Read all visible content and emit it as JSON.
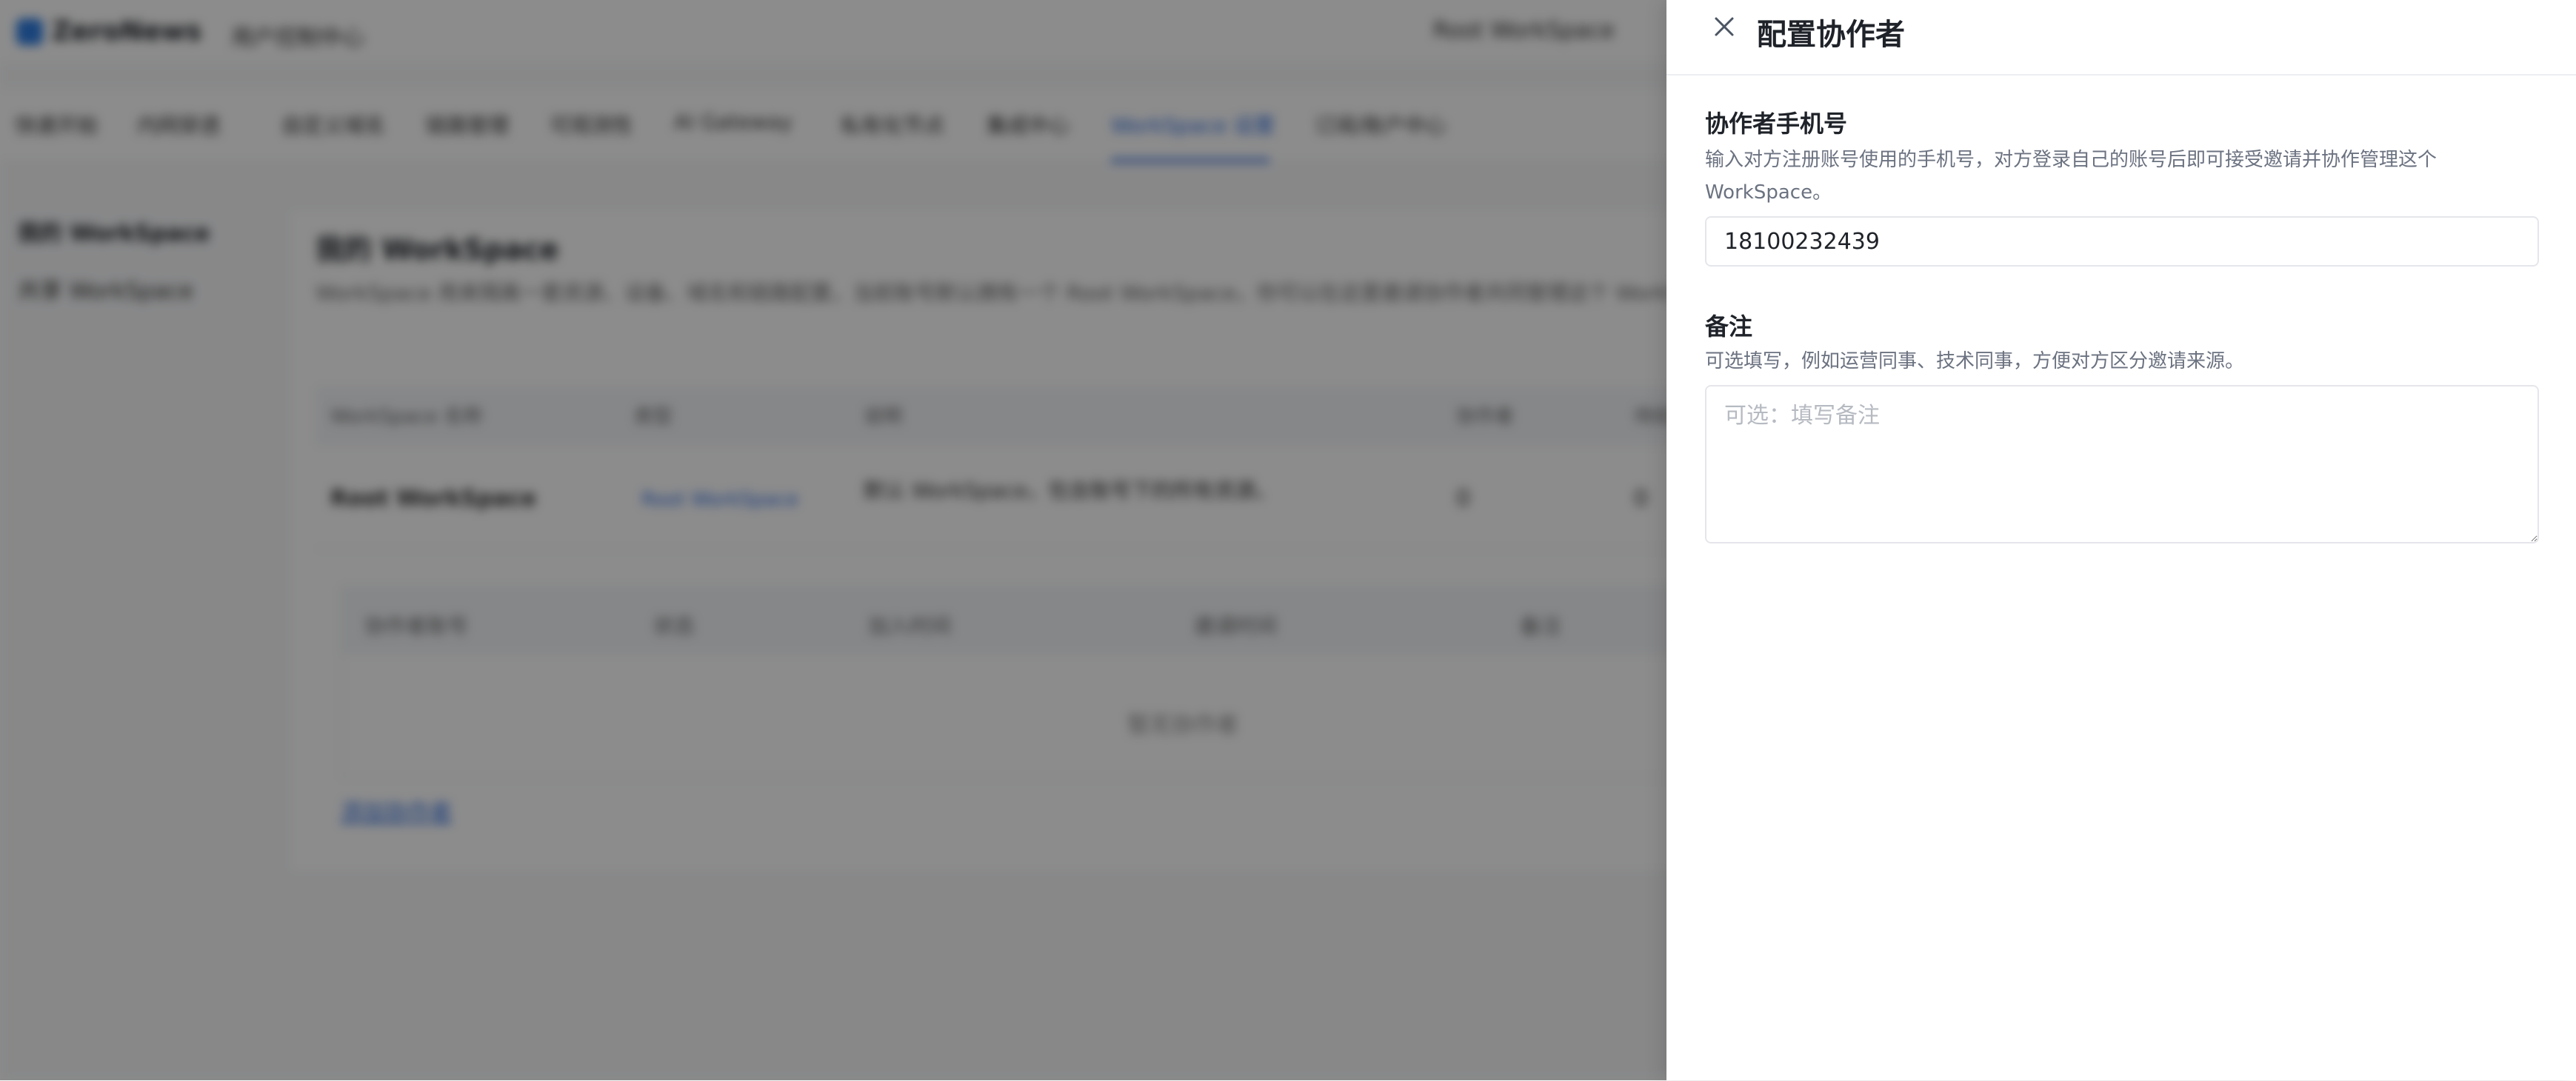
{
  "background": {
    "brand_name": "ZeroNews",
    "app_subtitle": "用户控制中心",
    "workspace_switch": "Root WorkSpace",
    "nav_items": [
      "快速开始",
      "内网穿透",
      "自定义域名",
      "链路管理",
      "可观测性",
      "AI Gateway",
      "私有化节点",
      "集成中心",
      "WorkSpace 设置",
      "订阅/账户中心"
    ],
    "side_items": [
      "我的 WorkSpace",
      "共享 WorkSpace"
    ],
    "main_title": "我的 WorkSpace",
    "main_desc": "WorkSpace 用来隔离一套资源、设备、域名和链路配置，当前账号默认拥有一个 Root WorkSpace，你可以在这里邀请协作者共同管理这个 WorkSpace。",
    "table_headers": [
      "WorkSpace 名称",
      "类型",
      "说明",
      "协作者",
      "待处理"
    ],
    "table_row": {
      "name": "Root WorkSpace",
      "type": "Root WorkSpace",
      "desc": "默认 WorkSpace，包含账号下的所有资源。",
      "collaborators": "0",
      "pending": "0"
    },
    "sub_headers": [
      "协作者账号",
      "状态",
      "加入时间",
      "邀请时间",
      "备注"
    ],
    "sub_empty": "暂无协作者",
    "add_link": "添加协作者"
  },
  "drawer": {
    "title": "配置协作者",
    "phone": {
      "label": "协作者手机号",
      "hint": "输入对方注册账号使用的手机号，对方登录自己的账号后即可接受邀请并协作管理这个 WorkSpace。",
      "value": "18100232439"
    },
    "note": {
      "label": "备注",
      "hint": "可选填写，例如运营同事、技术同事，方便对方区分邀请来源。",
      "placeholder": "可选：填写备注",
      "value": ""
    }
  }
}
